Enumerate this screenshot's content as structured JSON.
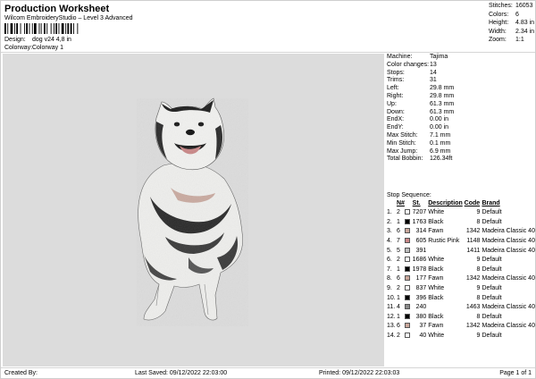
{
  "header": {
    "title": "Production Worksheet",
    "subtitle": "Wilcom EmbroideryStudio – Level 3 Advanced",
    "design_label": "Design:",
    "design_value": "dog v24 4,8 in",
    "colorway_label": "Colorway:",
    "colorway_value": "Colorway 1",
    "summary": [
      {
        "label": "Stitches:",
        "value": "16053"
      },
      {
        "label": "Colors:",
        "value": "6"
      },
      {
        "label": "Height:",
        "value": "4.83 in"
      },
      {
        "label": "Width:",
        "value": "2.34 in"
      },
      {
        "label": "Zoom:",
        "value": "1:1"
      }
    ]
  },
  "properties": [
    {
      "label": "Machine:",
      "value": "Tajima"
    },
    {
      "label": "Color changes:",
      "value": "13"
    },
    {
      "label": "Stops:",
      "value": "14"
    },
    {
      "label": "Trims:",
      "value": "31"
    },
    {
      "label": "Left:",
      "value": "29.8 mm"
    },
    {
      "label": "Right:",
      "value": "29.8 mm"
    },
    {
      "label": "Up:",
      "value": "61.3 mm"
    },
    {
      "label": "Down:",
      "value": "61.3 mm"
    },
    {
      "label": "EndX:",
      "value": "0.00 in"
    },
    {
      "label": "EndY:",
      "value": "0.00 in"
    },
    {
      "label": "Max Stitch:",
      "value": "7.1 mm"
    },
    {
      "label": "Min Stitch:",
      "value": "0.1 mm"
    },
    {
      "label": "Max Jump:",
      "value": "6.9 mm"
    },
    {
      "label": "Total Bobbin:",
      "value": "126.34ft"
    }
  ],
  "stop_sequence": {
    "caption": "Stop Sequence:",
    "columns": [
      "",
      "N#",
      "St.",
      "Description",
      "Code",
      "Brand"
    ],
    "rows": [
      {
        "idx": "1.",
        "n": "2",
        "st": "7207",
        "desc": "White",
        "code": "9",
        "brand": "Default",
        "color": "#ffffff"
      },
      {
        "idx": "2.",
        "n": "1",
        "st": "1763",
        "desc": "Black",
        "code": "8",
        "brand": "Default",
        "color": "#000000"
      },
      {
        "idx": "3.",
        "n": "6",
        "st": "314",
        "desc": "Fawn",
        "code": "1342",
        "brand": "Madeira Classic 40",
        "color": "#c8a69a"
      },
      {
        "idx": "4.",
        "n": "7",
        "st": "605",
        "desc": "Rustic Pink",
        "code": "1148",
        "brand": "Madeira Classic 40",
        "color": "#c98787"
      },
      {
        "idx": "5.",
        "n": "5",
        "st": "391",
        "desc": "",
        "code": "1411",
        "brand": "Madeira Classic 40",
        "color": "#bdbdbd"
      },
      {
        "idx": "6.",
        "n": "2",
        "st": "1686",
        "desc": "White",
        "code": "9",
        "brand": "Default",
        "color": "#ffffff"
      },
      {
        "idx": "7.",
        "n": "1",
        "st": "1978",
        "desc": "Black",
        "code": "8",
        "brand": "Default",
        "color": "#000000"
      },
      {
        "idx": "8.",
        "n": "6",
        "st": "177",
        "desc": "Fawn",
        "code": "1342",
        "brand": "Madeira Classic 40",
        "color": "#c8a69a"
      },
      {
        "idx": "9.",
        "n": "2",
        "st": "837",
        "desc": "White",
        "code": "9",
        "brand": "Default",
        "color": "#ffffff"
      },
      {
        "idx": "10.",
        "n": "1",
        "st": "396",
        "desc": "Black",
        "code": "8",
        "brand": "Default",
        "color": "#000000"
      },
      {
        "idx": "11.",
        "n": "4",
        "st": "240",
        "desc": "",
        "code": "1463",
        "brand": "Madeira Classic 40",
        "color": "#8a8a8a"
      },
      {
        "idx": "12.",
        "n": "1",
        "st": "380",
        "desc": "Black",
        "code": "8",
        "brand": "Default",
        "color": "#000000"
      },
      {
        "idx": "13.",
        "n": "6",
        "st": "37",
        "desc": "Fawn",
        "code": "1342",
        "brand": "Madeira Classic 40",
        "color": "#c8a69a"
      },
      {
        "idx": "14.",
        "n": "2",
        "st": "40",
        "desc": "White",
        "code": "9",
        "brand": "Default",
        "color": "#ffffff"
      }
    ]
  },
  "footer": {
    "created_by": "Created By:",
    "last_saved": "Last Saved: 09/12/2022 22:03:00",
    "printed": "Printed: 09/12/2022 22:03:03",
    "page": "Page 1 of 1"
  },
  "preview_background": "#dcdcdc"
}
